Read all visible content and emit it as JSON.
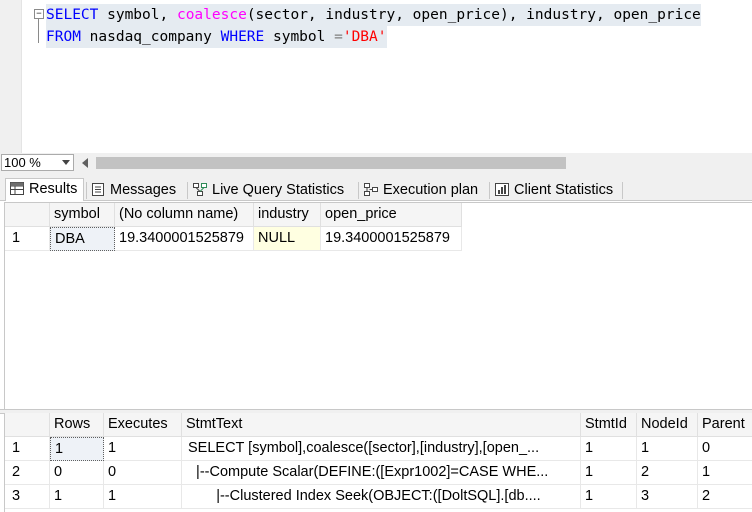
{
  "editor": {
    "line1": {
      "select": "SELECT",
      "a": " symbol, ",
      "fn": "coalesce",
      "b": "(sector, industry, open_price)",
      "c": ", industry, open_price"
    },
    "line2": {
      "from": "FROM",
      "table": " nasdaq_company ",
      "where": "WHERE",
      "col": " symbol ",
      "eq": "=",
      "str": "'DBA'"
    }
  },
  "zoom": {
    "value": "100 %"
  },
  "tabs": [
    {
      "label": "Results",
      "icon": "grid-icon"
    },
    {
      "label": "Messages",
      "icon": "messages-icon"
    },
    {
      "label": "Live Query Statistics",
      "icon": "live-stats-icon"
    },
    {
      "label": "Execution plan",
      "icon": "execution-plan-icon"
    },
    {
      "label": "Client Statistics",
      "icon": "client-stats-icon"
    }
  ],
  "results": {
    "columns": [
      "symbol",
      "(No column name)",
      "industry",
      "open_price"
    ],
    "rows": [
      {
        "num": "1",
        "cells": [
          "DBA",
          "19.3400001525879",
          "NULL",
          "19.3400001525879"
        ]
      }
    ]
  },
  "stats": {
    "columns": [
      "Rows",
      "Executes",
      "StmtText",
      "StmtId",
      "NodeId",
      "Parent"
    ],
    "rows": [
      {
        "num": "1",
        "cells": [
          "1",
          "1",
          "SELECT [symbol],coalesce([sector],[industry],[open_...",
          "1",
          "1",
          "0"
        ]
      },
      {
        "num": "2",
        "cells": [
          "0",
          "0",
          "  |--Compute Scalar(DEFINE:([Expr1002]=CASE WHE...",
          "1",
          "2",
          "1"
        ]
      },
      {
        "num": "3",
        "cells": [
          "1",
          "1",
          "       |--Clustered Index Seek(OBJECT:([DoltSQL].[db....",
          "1",
          "3",
          "2"
        ]
      }
    ]
  },
  "colors": {
    "keyword": "#0000ff",
    "function": "#ff00ff",
    "string": "#ff0000",
    "null_bg": "#ffffe1"
  }
}
